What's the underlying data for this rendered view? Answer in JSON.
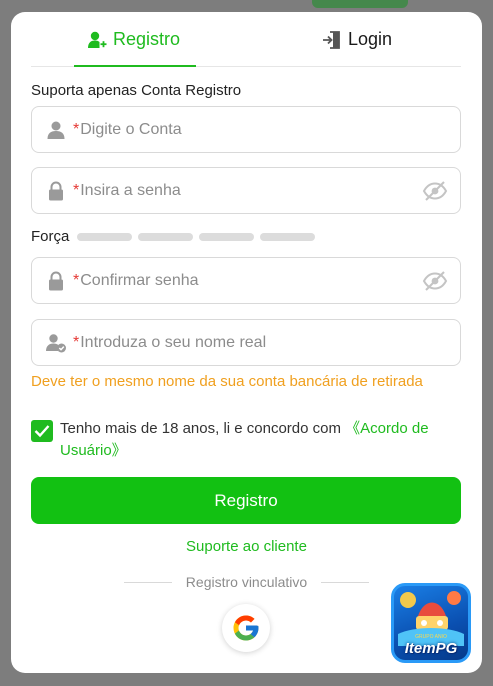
{
  "tabs": {
    "register_label": "Registro",
    "login_label": "Login"
  },
  "form": {
    "hint": "Suporta apenas Conta Registro",
    "account_placeholder": "Digite o Conta",
    "password_placeholder": "Insira a senha",
    "strength_label": "Força",
    "confirm_placeholder": "Confirmar senha",
    "realname_placeholder": "Introduza o seu nome real",
    "required_mark": "*",
    "realname_warning": "Deve ter o mesmo nome da sua conta bancária de retirada",
    "agree_text": "Tenho mais de 18 anos, li e concordo com ",
    "agree_link": "《Acordo de Usuário》",
    "agree_checked": true,
    "submit_label": "Registro",
    "support_label": "Suporte ao cliente",
    "bind_label": "Registro vinculativo"
  },
  "promo": {
    "brand": "ItemPG",
    "sub": "GRUPO ANIO"
  },
  "colors": {
    "accent": "#1fbb1f",
    "required": "#e53935",
    "warning": "#f0a020"
  },
  "icons": [
    "user-plus-icon",
    "login-icon",
    "user-icon",
    "lock-icon",
    "eye-off-icon",
    "user-check-icon",
    "check-icon",
    "google-icon"
  ]
}
